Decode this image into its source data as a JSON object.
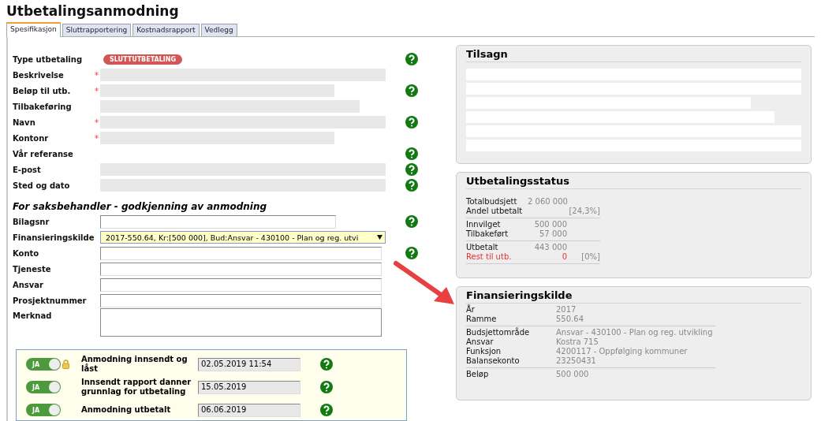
{
  "title": "Utbetalingsanmodning",
  "tabs": [
    {
      "label": "Spesifikasjon",
      "selected": true
    },
    {
      "label": "Sluttrapportering",
      "selected": false
    },
    {
      "label": "Kostnadsrapport",
      "selected": false
    },
    {
      "label": "Vedlegg",
      "selected": false
    }
  ],
  "applicant_rows": [
    {
      "label": "Type utbetaling",
      "kind": "badge",
      "badge": "SLUTTUTBETALING",
      "help": true
    },
    {
      "label": "Beskrivelse",
      "required_mark": "*",
      "kind": "long",
      "help": false
    },
    {
      "label": "Beløp til utb.",
      "required_mark": "*",
      "kind": "short",
      "help": true
    },
    {
      "label": "Tilbakeføring",
      "kind": "medium",
      "help": false
    },
    {
      "label": "Navn",
      "required_mark": "*",
      "kind": "long",
      "help": true
    },
    {
      "label": "Kontonr",
      "required_mark": "*",
      "kind": "short",
      "help": false
    },
    {
      "label": "Vår referanse",
      "kind": "none",
      "help": true
    },
    {
      "label": "E-post",
      "kind": "long",
      "help": true
    },
    {
      "label": "Sted og dato",
      "kind": "long",
      "help": true
    }
  ],
  "caseworker_heading": "For saksbehandler - godkjenning av anmodning",
  "caseworker_rows": [
    {
      "label": "Bilagsnr",
      "kind": "input-short",
      "help": true
    },
    {
      "label": "Finansieringskilde",
      "kind": "select",
      "value": "2017-550.64, Kr:[500 000], Bud:Ansvar - 430100 - Plan og reg. utvi",
      "help": false
    },
    {
      "label": "Konto",
      "kind": "input",
      "help": true
    },
    {
      "label": "Tjeneste",
      "kind": "input",
      "help": false
    },
    {
      "label": "Ansvar",
      "kind": "input",
      "help": false
    },
    {
      "label": "Prosjektnummer",
      "kind": "input",
      "help": false
    },
    {
      "label": "Merknad",
      "kind": "textarea",
      "help": false
    }
  ],
  "approvals": [
    {
      "on": true,
      "toggle_label": "JA",
      "locked": true,
      "label": "Anmodning innsendt og låst",
      "date": "02.05.2019 11:54"
    },
    {
      "on": true,
      "toggle_label": "JA",
      "locked": false,
      "label": "Innsendt rapport danner grunnlag for utbetaling",
      "date": "15.05.2019"
    },
    {
      "on": true,
      "toggle_label": "JA",
      "locked": false,
      "label": "Anmodning utbetalt",
      "date": "06.06.2019"
    }
  ],
  "tilsagn": {
    "title": "Tilsagn"
  },
  "status": {
    "title": "Utbetalingsstatus",
    "groups": [
      [
        {
          "label": "Totalbudsjett",
          "value": "2 060 000",
          "alert": false
        },
        {
          "label": "Andel utbetalt",
          "percent": "[24,3%]",
          "alert": false
        }
      ],
      [
        {
          "label": "Innvilget",
          "value": "500 000",
          "alert": false
        },
        {
          "label": "Tilbakeført",
          "value": "57 000",
          "alert": false
        }
      ],
      [
        {
          "label": "Utbetalt",
          "value": "443 000",
          "alert": false
        },
        {
          "label": "Rest til utb.",
          "value": "0",
          "percent": "[0%]",
          "alert": true
        }
      ]
    ]
  },
  "source": {
    "title": "Finansieringskilde",
    "groups": [
      [
        {
          "label": "År",
          "value": "2017"
        },
        {
          "label": "Ramme",
          "value": "550.64"
        }
      ],
      [
        {
          "label": "Budsjettområde",
          "value": "Ansvar - 430100 - Plan og reg. utvikling"
        },
        {
          "label": "Ansvar",
          "value": "Kostra 715"
        },
        {
          "label": "Funksjon",
          "value": "4200117 - Oppfølging kommuner"
        },
        {
          "label": "Balansekonto",
          "value": "23250431"
        }
      ],
      [
        {
          "label": "Beløp",
          "value": "500 000"
        }
      ]
    ]
  }
}
